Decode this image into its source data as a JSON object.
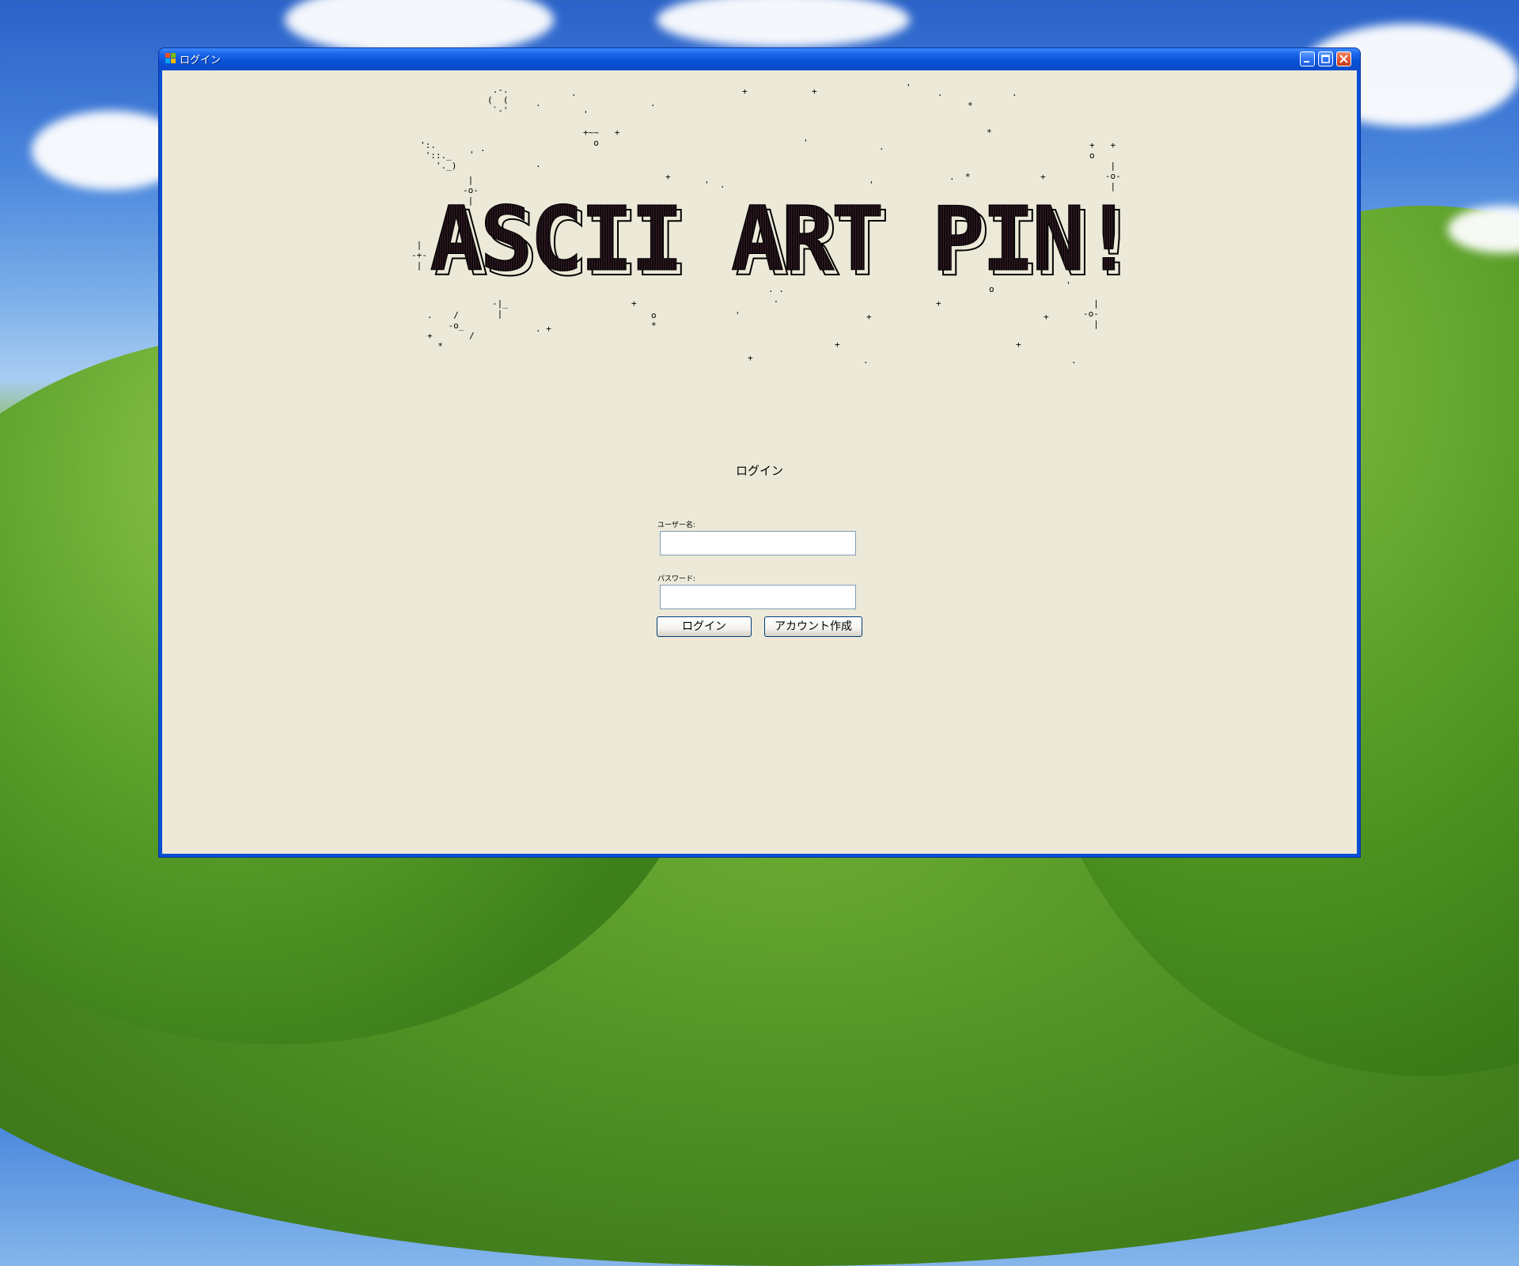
{
  "window": {
    "title": "ログイン"
  },
  "banner": {
    "title_art": "ASCII ART PIN!"
  },
  "login": {
    "heading": "ログイン",
    "username_label": "ユーザー名:",
    "username_value": "",
    "password_label": "パスワード:",
    "password_value": "",
    "login_button": "ログイン",
    "create_account_button": "アカウント作成"
  },
  "colors": {
    "titlebar": "#0a52d6",
    "client_bg": "#ece9d8",
    "input_border": "#7f9db9",
    "close_button": "#e0532c"
  },
  "icons": [
    "windows-flag-icon",
    "minimize-icon",
    "maximize-icon",
    "close-icon"
  ]
}
